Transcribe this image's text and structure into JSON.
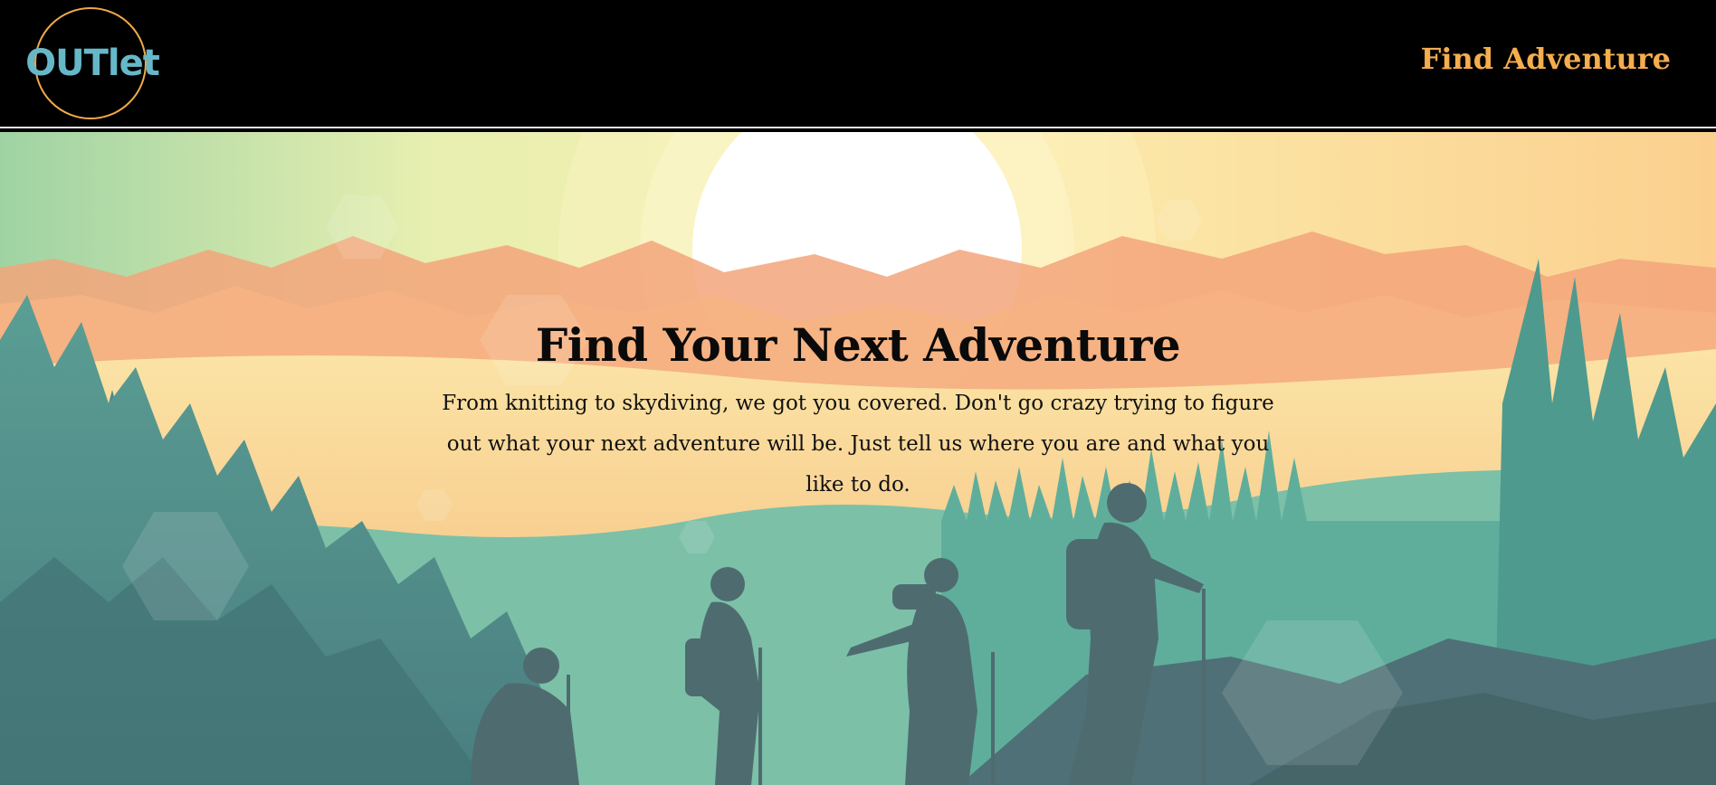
{
  "header": {
    "logo_text": "OUTlet",
    "nav_link_label": "Find Adventure"
  },
  "hero": {
    "title": "Find Your Next Adventure",
    "description": "From knitting to skydiving, we got you covered. Don't go crazy trying to figure out what your next adventure will be. Just tell us where you are and what you like to do.",
    "illustration": "hikers-silhouette-at-sunset"
  },
  "colors": {
    "header_bg": "#000000",
    "logo_text": "#66b8c8",
    "logo_ring": "#f0a94a",
    "nav_link": "#f5ad4e",
    "title_text": "#0a0a0a"
  }
}
